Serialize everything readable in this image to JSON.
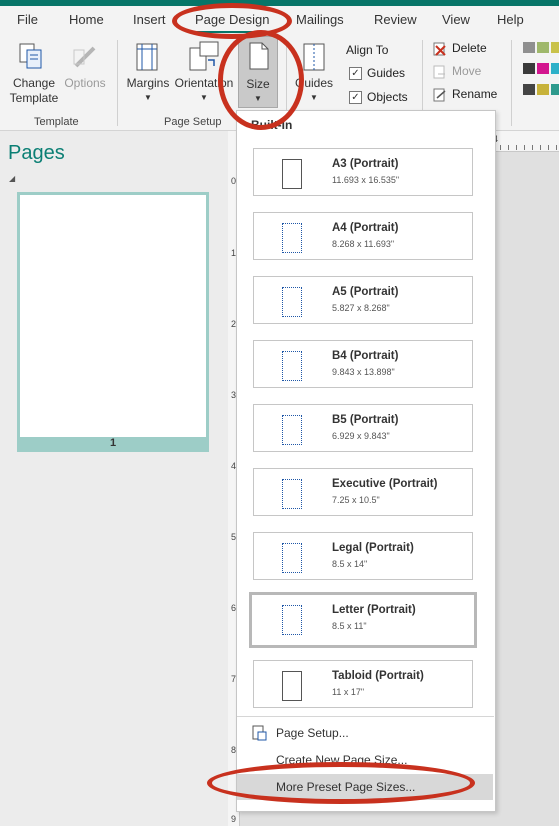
{
  "tabs": [
    "File",
    "Home",
    "Insert",
    "Page Design",
    "Mailings",
    "Review",
    "View",
    "Help"
  ],
  "ribbon": {
    "change_template": "Change\nTemplate",
    "options": "Options",
    "template_group": "Template",
    "margins": "Margins",
    "orientation": "Orientation",
    "size": "Size",
    "page_setup_group": "Page Setup",
    "guides": "Guides",
    "align_to": "Align To",
    "guides_check": "Guides",
    "objects_check": "Objects",
    "delete": "Delete",
    "move": "Move",
    "rename": "Rename",
    "accent": "#077568"
  },
  "pages_pane": {
    "title": "Pages",
    "page_number": "1"
  },
  "ruler": {
    "h": [
      "4"
    ],
    "v": [
      "0",
      "1",
      "2",
      "3",
      "4",
      "5",
      "6",
      "7",
      "8",
      "9"
    ]
  },
  "dropdown": {
    "header": "Built-In",
    "sizes": [
      {
        "name": "A3 (Portrait)",
        "dim": "11.693 x 16.535\""
      },
      {
        "name": "A4 (Portrait)",
        "dim": "8.268 x 11.693\""
      },
      {
        "name": "A5 (Portrait)",
        "dim": "5.827 x 8.268\""
      },
      {
        "name": "B4 (Portrait)",
        "dim": "9.843 x 13.898\""
      },
      {
        "name": "B5 (Portrait)",
        "dim": "6.929 x 9.843\""
      },
      {
        "name": "Executive (Portrait)",
        "dim": "7.25 x 10.5\""
      },
      {
        "name": "Legal (Portrait)",
        "dim": "8.5 x 14\""
      },
      {
        "name": "Letter (Portrait)",
        "dim": "8.5 x 11\""
      },
      {
        "name": "Tabloid (Portrait)",
        "dim": "11 x 17\""
      }
    ],
    "page_setup": "Page Setup...",
    "create_new": "Create New Page Size...",
    "more_preset": "More Preset Page Sizes..."
  }
}
